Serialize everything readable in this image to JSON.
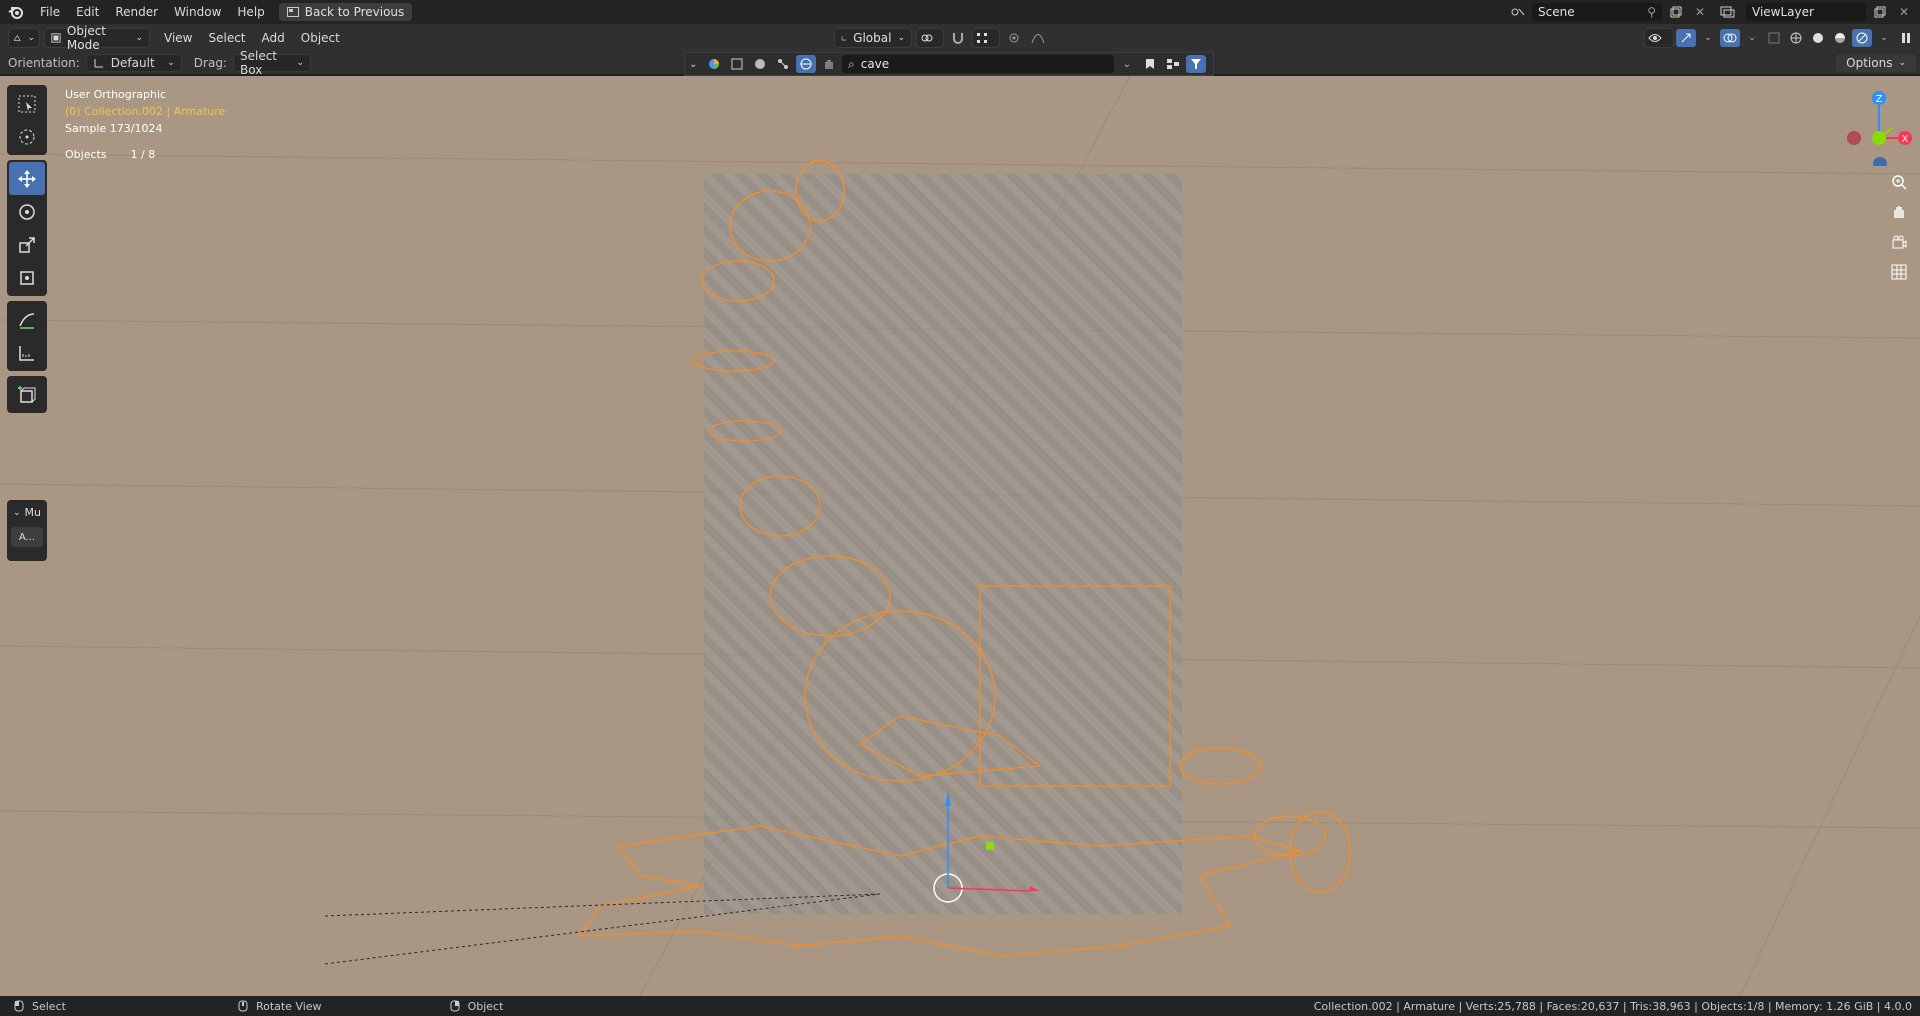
{
  "menu": {
    "items": [
      "File",
      "Edit",
      "Render",
      "Window",
      "Help"
    ],
    "back_label": "Back to Previous"
  },
  "scene": {
    "name": "Scene",
    "view_layer": "ViewLayer"
  },
  "header": {
    "mode": "Object Mode",
    "menus": [
      "View",
      "Select",
      "Add",
      "Object"
    ],
    "transform_orientation": "Global"
  },
  "tool_settings": {
    "orientation_label": "Orientation:",
    "orientation_value": "Default",
    "drag_label": "Drag:",
    "drag_value": "Select Box",
    "options_label": "Options"
  },
  "search": {
    "value": "cave"
  },
  "overlay": {
    "view_name": "User Orthographic",
    "collection_line": "(0) Collection.002 | Armature",
    "sample": "Sample 173/1024",
    "objects_label": "Objects",
    "objects_value": "1 / 8"
  },
  "sidebar_panel": {
    "title": "Mu",
    "button": "A..."
  },
  "gizmo": {
    "z": "Z",
    "x": "X"
  },
  "status": {
    "select": "Select",
    "rotate": "Rotate View",
    "object": "Object",
    "stats": "Collection.002 | Armature | Verts:25,788 | Faces:20,637 | Tris:38,963 | Objects:1/8 | Memory: 1.26 GiB | 4.0.0"
  },
  "colors": {
    "accent": "#4672b3",
    "viewport_bg": "#aa9783",
    "armature_orange": "#ff8c1a",
    "axis_x": "#ff3352",
    "axis_y": "#8bdc00",
    "axis_z": "#2890ff"
  }
}
